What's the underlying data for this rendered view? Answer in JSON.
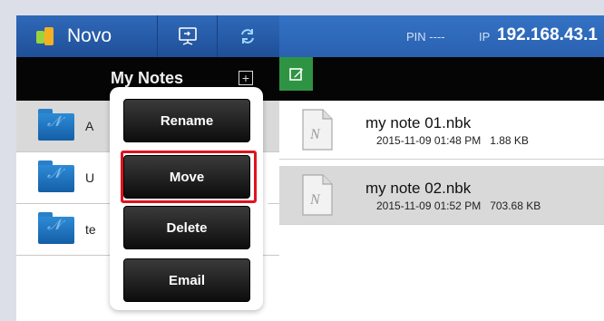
{
  "header": {
    "app_name": "Novo",
    "pin_label": "PIN",
    "pin_value": "----",
    "ip_label": "IP",
    "ip_value": "192.168.43.1"
  },
  "notes_panel": {
    "title": "My Notes",
    "add_symbol": "+",
    "folders": [
      {
        "label": "A",
        "selected": true
      },
      {
        "label": "U",
        "selected": false
      },
      {
        "label": "te",
        "selected": false
      }
    ]
  },
  "files_panel": {
    "files": [
      {
        "name": "my note 01.nbk",
        "date": "2015-11-09 01:48 PM",
        "size": "1.88 KB",
        "selected": false
      },
      {
        "name": "my note 02.nbk",
        "date": "2015-11-09 01:52 PM",
        "size": "703.68 KB",
        "selected": true
      }
    ]
  },
  "context_menu": {
    "items": [
      "Rename",
      "Move",
      "Delete",
      "Email"
    ],
    "highlighted": "Move"
  },
  "icons": {
    "logo": "novo-logo-icon",
    "screen_share": "screen-share-icon",
    "refresh": "refresh-icon",
    "add": "add-folder-icon",
    "edit": "edit-note-icon",
    "folder": "folder-icon",
    "file": "note-file-icon"
  },
  "colors": {
    "header_blue": "#2a61b0",
    "edit_green": "#2e9443",
    "highlight_red": "#e0121f"
  }
}
